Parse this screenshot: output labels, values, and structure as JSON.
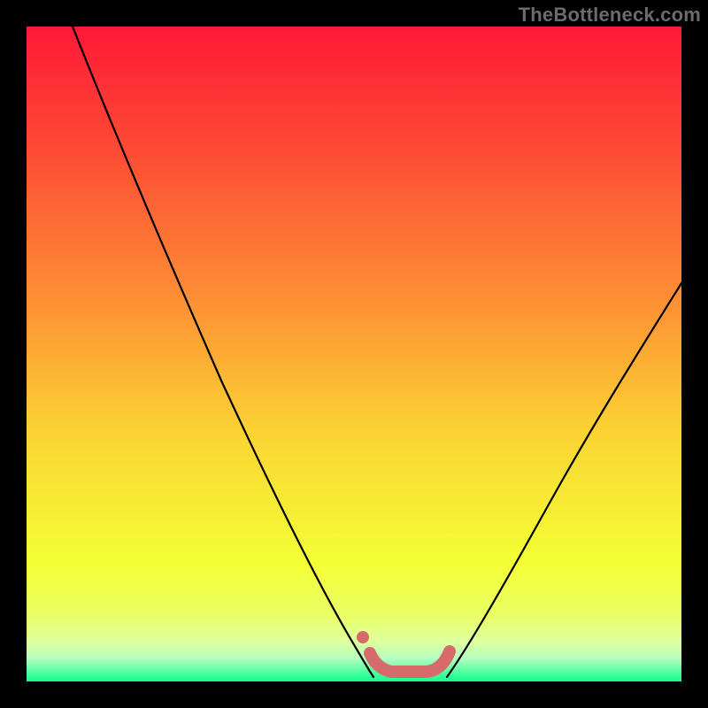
{
  "watermark": "TheBottleneck.com",
  "chart_data": {
    "type": "line",
    "title": "",
    "xlabel": "",
    "ylabel": "",
    "xlim": [
      0,
      100
    ],
    "ylim": [
      0,
      100
    ],
    "grid": false,
    "legend": null,
    "background_gradient_stops": [
      {
        "pos": 0.0,
        "color": "#fe1937"
      },
      {
        "pos": 0.2,
        "color": "#fd4e34"
      },
      {
        "pos": 0.42,
        "color": "#fd9034"
      },
      {
        "pos": 0.62,
        "color": "#fbd334"
      },
      {
        "pos": 0.82,
        "color": "#f3ff34"
      },
      {
        "pos": 0.9,
        "color": "#e9ff67"
      },
      {
        "pos": 0.94,
        "color": "#deffa0"
      },
      {
        "pos": 0.965,
        "color": "#b4ffc0"
      },
      {
        "pos": 0.987,
        "color": "#49ff9e"
      },
      {
        "pos": 1.0,
        "color": "#12ff8f"
      }
    ],
    "series": [
      {
        "name": "left-curve",
        "stroke": "#000000",
        "points": [
          {
            "x": 7,
            "y": 100
          },
          {
            "x": 12,
            "y": 90
          },
          {
            "x": 18,
            "y": 78
          },
          {
            "x": 24,
            "y": 66
          },
          {
            "x": 30,
            "y": 54
          },
          {
            "x": 36,
            "y": 42
          },
          {
            "x": 42,
            "y": 30
          },
          {
            "x": 47,
            "y": 19
          },
          {
            "x": 50,
            "y": 11
          },
          {
            "x": 52,
            "y": 6
          }
        ]
      },
      {
        "name": "right-curve",
        "stroke": "#000000",
        "points": [
          {
            "x": 64,
            "y": 6
          },
          {
            "x": 68,
            "y": 12
          },
          {
            "x": 74,
            "y": 22
          },
          {
            "x": 80,
            "y": 32
          },
          {
            "x": 86,
            "y": 42
          },
          {
            "x": 92,
            "y": 51
          },
          {
            "x": 100,
            "y": 62
          }
        ]
      },
      {
        "name": "bottom-highlight",
        "stroke": "#d76a6a",
        "points": [
          {
            "x": 52,
            "y": 4.5
          },
          {
            "x": 53,
            "y": 2.5
          },
          {
            "x": 56,
            "y": 1.5
          },
          {
            "x": 60,
            "y": 1.5
          },
          {
            "x": 63,
            "y": 2.5
          },
          {
            "x": 64.5,
            "y": 5
          }
        ]
      },
      {
        "name": "bottom-highlight-dot",
        "stroke": "#d76a6a",
        "points": [
          {
            "x": 51,
            "y": 7
          }
        ]
      }
    ]
  }
}
